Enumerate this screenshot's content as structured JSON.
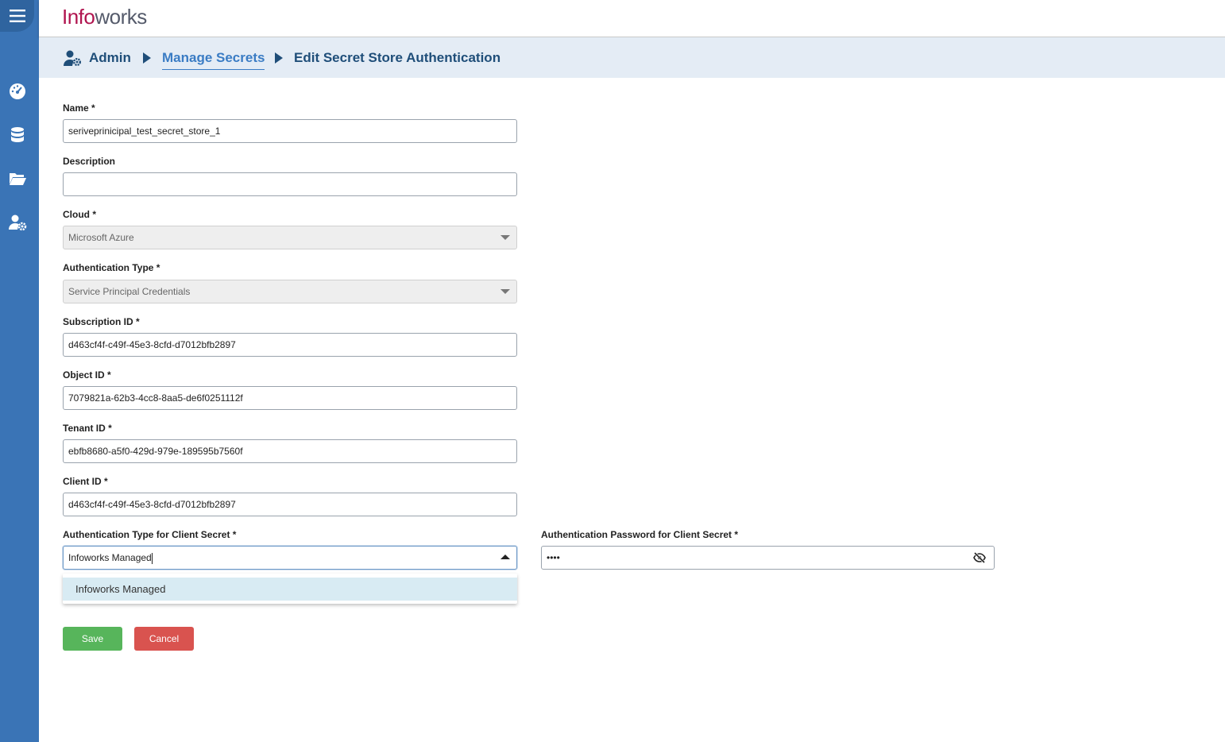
{
  "app": {
    "logo_prefix": "Info",
    "logo_suffix": "works"
  },
  "sidebar": {
    "items": [
      {
        "icon": "dashboard-gauge-icon"
      },
      {
        "icon": "database-icon"
      },
      {
        "icon": "folder-open-icon"
      },
      {
        "icon": "user-settings-icon"
      }
    ]
  },
  "breadcrumb": {
    "items": [
      "Admin",
      "Manage Secrets",
      "Edit Secret Store Authentication"
    ]
  },
  "form": {
    "name": {
      "label": "Name *",
      "value": "seriveprinicipal_test_secret_store_1"
    },
    "description": {
      "label": "Description",
      "value": ""
    },
    "cloud": {
      "label": "Cloud *",
      "value": "Microsoft Azure"
    },
    "auth_type": {
      "label": "Authentication Type *",
      "value": "Service Principal Credentials"
    },
    "subscription_id": {
      "label": "Subscription ID *",
      "value": "d463cf4f-c49f-45e3-8cfd-d7012bfb2897"
    },
    "object_id": {
      "label": "Object ID *",
      "value": "7079821a-62b3-4cc8-8aa5-de6f0251112f"
    },
    "tenant_id": {
      "label": "Tenant ID *",
      "value": "ebfb8680-a5f0-429d-979e-189595b7560f"
    },
    "client_id": {
      "label": "Client ID *",
      "value": "d463cf4f-c49f-45e3-8cfd-d7012bfb2897"
    },
    "client_secret_auth_type": {
      "label": "Authentication Type for Client Secret *",
      "value": "Infoworks Managed",
      "options": [
        "Infoworks Managed"
      ]
    },
    "client_secret_password": {
      "label": "Authentication Password for Client Secret *",
      "value": "••••"
    },
    "save_label": "Save",
    "cancel_label": "Cancel"
  }
}
